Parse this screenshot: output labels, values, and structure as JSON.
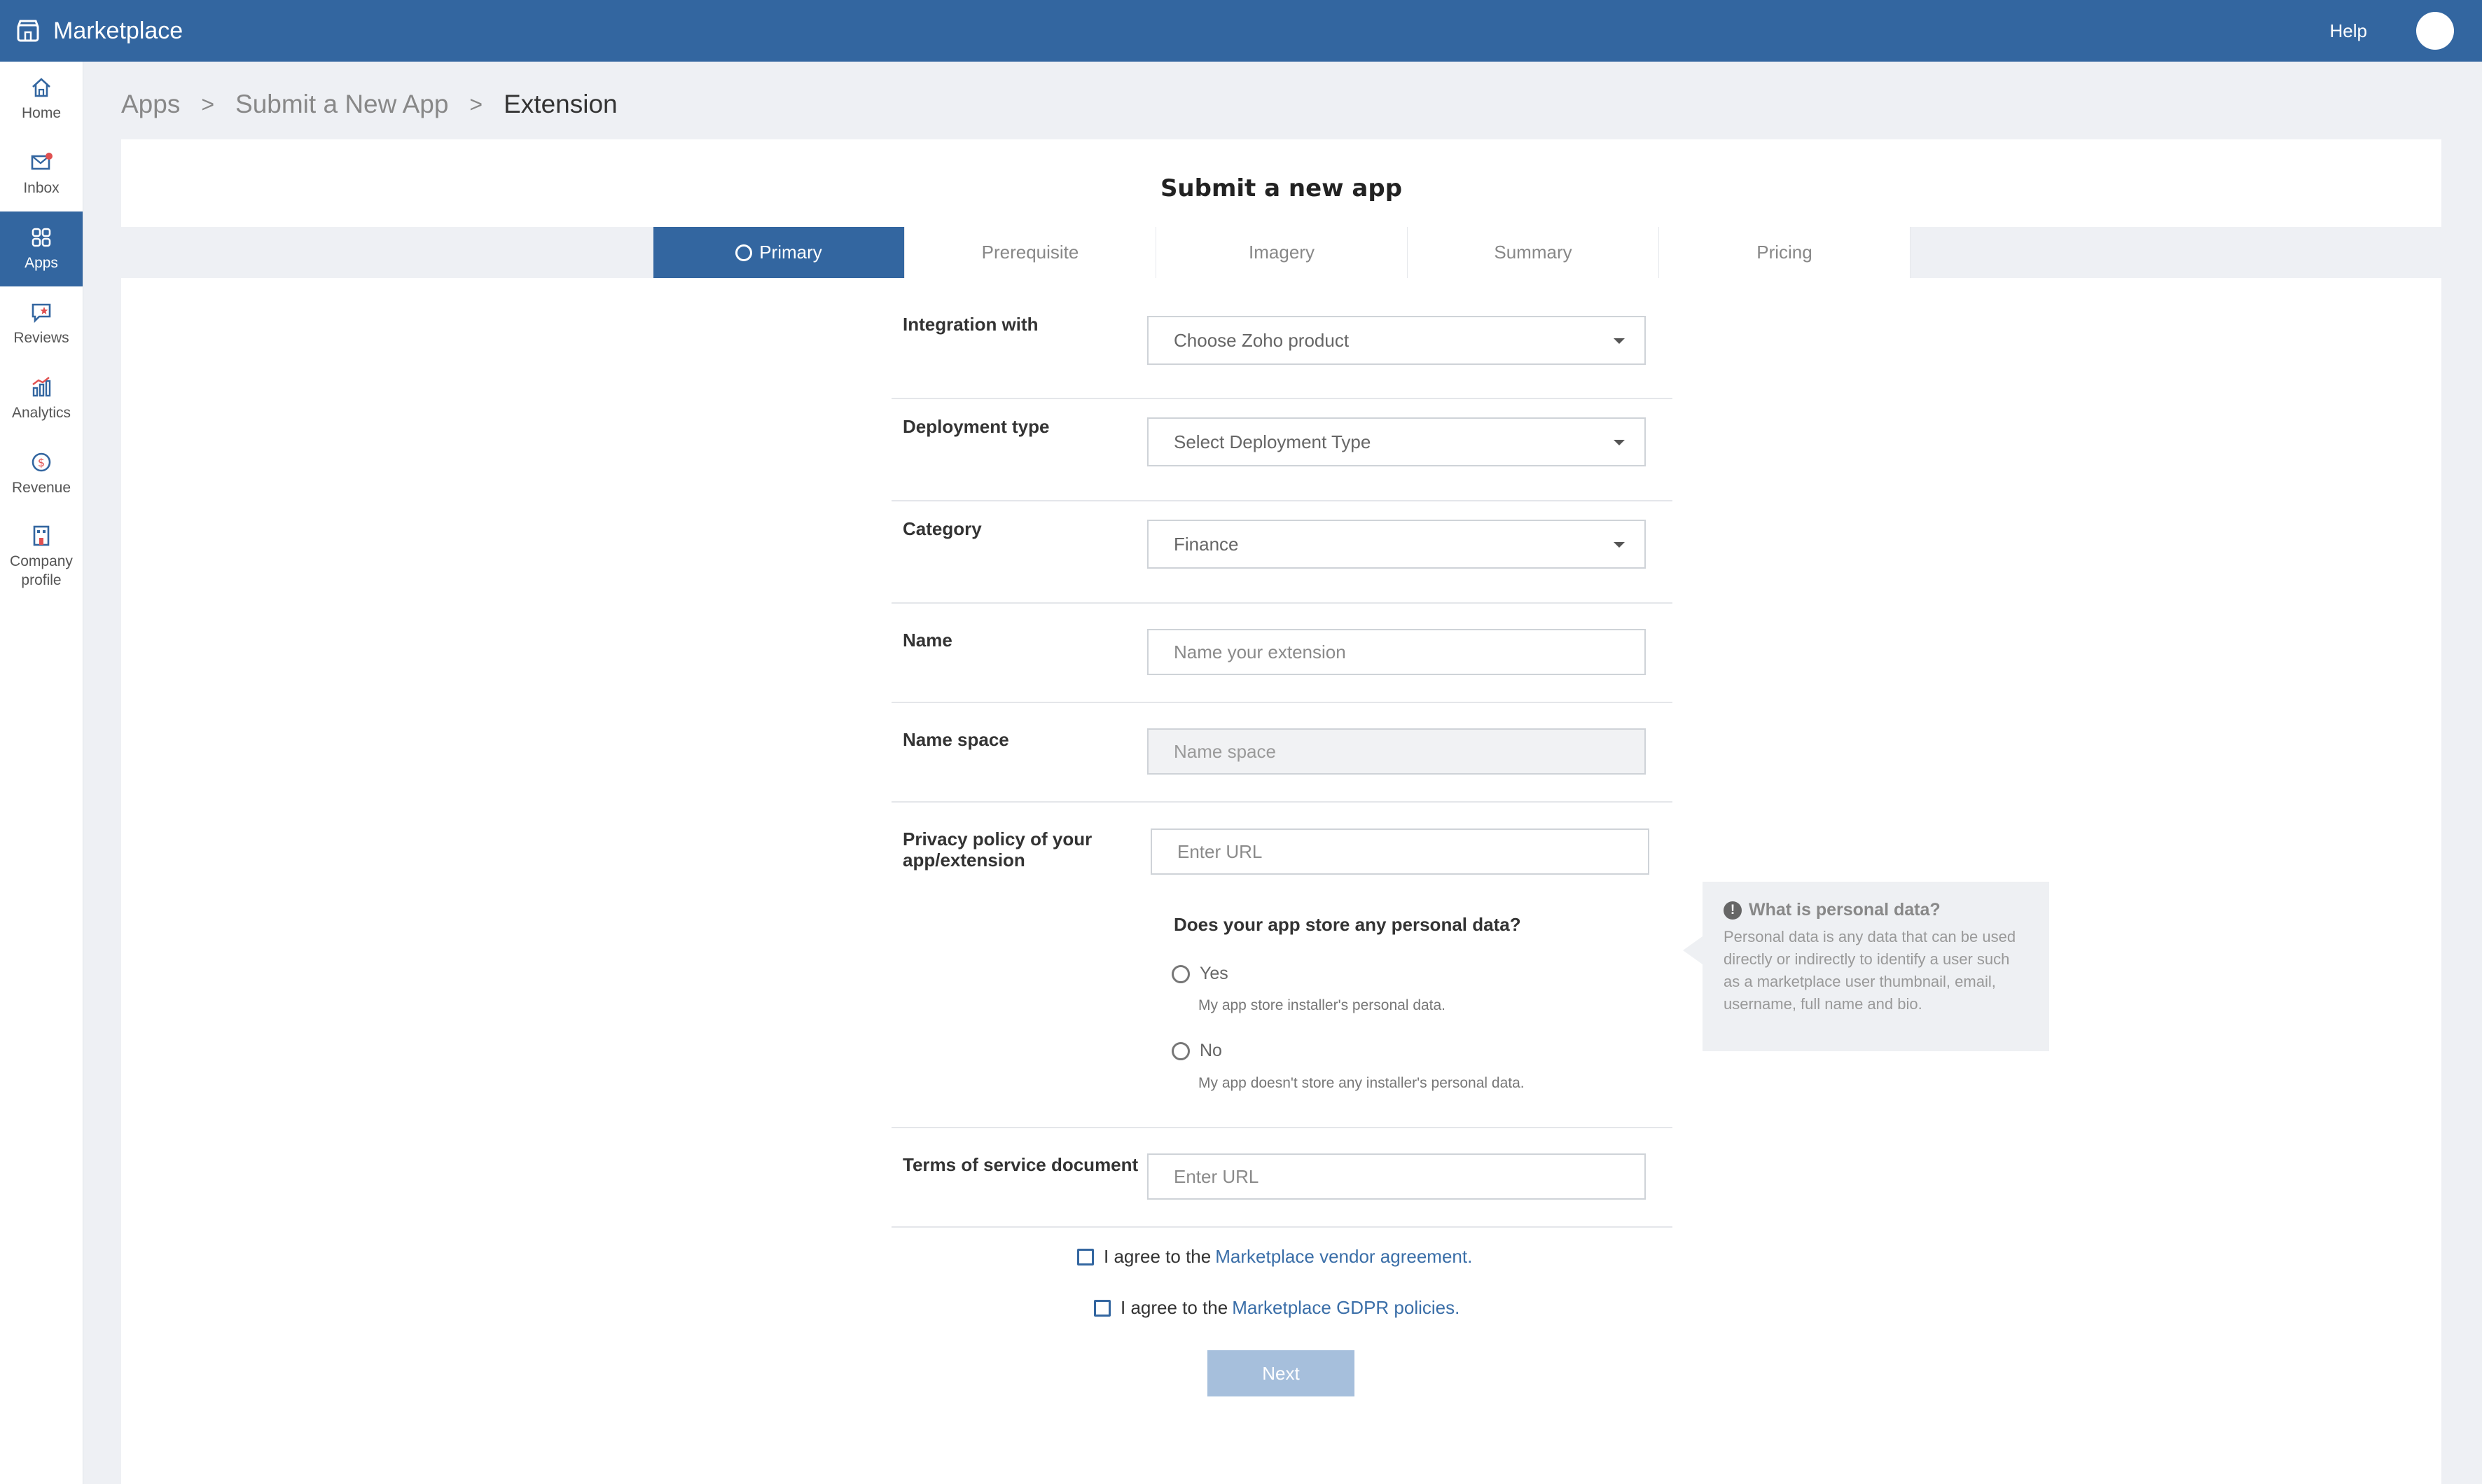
{
  "app": {
    "title": "Marketplace",
    "help_label": "Help"
  },
  "sidebar": {
    "items": [
      {
        "label": "Home",
        "icon": "home-icon"
      },
      {
        "label": "Inbox",
        "icon": "inbox-icon"
      },
      {
        "label": "Apps",
        "icon": "apps-grid-icon",
        "active": true
      },
      {
        "label": "Reviews",
        "icon": "reviews-icon"
      },
      {
        "label": "Analytics",
        "icon": "analytics-icon"
      },
      {
        "label": "Revenue",
        "icon": "revenue-icon"
      },
      {
        "label": "Company profile",
        "icon": "company-icon"
      }
    ]
  },
  "breadcrumb": {
    "items": [
      "Apps",
      "Submit a New App",
      "Extension"
    ],
    "separator": ">"
  },
  "page": {
    "title": "Submit a new app"
  },
  "tabs": [
    "Primary",
    "Prerequisite",
    "Imagery",
    "Summary",
    "Pricing"
  ],
  "form": {
    "integration": {
      "label": "Integration with",
      "value": "Choose Zoho product"
    },
    "deployment": {
      "label": "Deployment type",
      "value": "Select Deployment Type"
    },
    "category": {
      "label": "Category",
      "value": "Finance"
    },
    "name": {
      "label": "Name",
      "placeholder": "Name your extension"
    },
    "namespace": {
      "label": "Name space",
      "placeholder": "Name space"
    },
    "privacy": {
      "label_line1": "Privacy policy of your",
      "label_line2": "app/extension",
      "placeholder": "Enter URL",
      "question": "Does your app store any personal data?",
      "yes_label": "Yes",
      "yes_desc": "My app store installer's personal data.",
      "no_label": "No",
      "no_desc": "My app doesn't store any installer's personal data."
    },
    "terms": {
      "label": "Terms of service document",
      "placeholder": "Enter URL"
    }
  },
  "info": {
    "title": "What is personal data?",
    "text": "Personal data is any data that can be used directly or indirectly to identify a user such as a marketplace user thumbnail, email, username, full name and bio."
  },
  "agreements": {
    "vendor_prefix": "I agree to the",
    "vendor_link": "Marketplace vendor agreement.",
    "gdpr_prefix": "I agree to the",
    "gdpr_link": "Marketplace GDPR policies."
  },
  "next_label": "Next",
  "colors": {
    "primary": "#3366a0",
    "link": "#3a6ea8",
    "button_disabled": "#a6bfdc"
  }
}
